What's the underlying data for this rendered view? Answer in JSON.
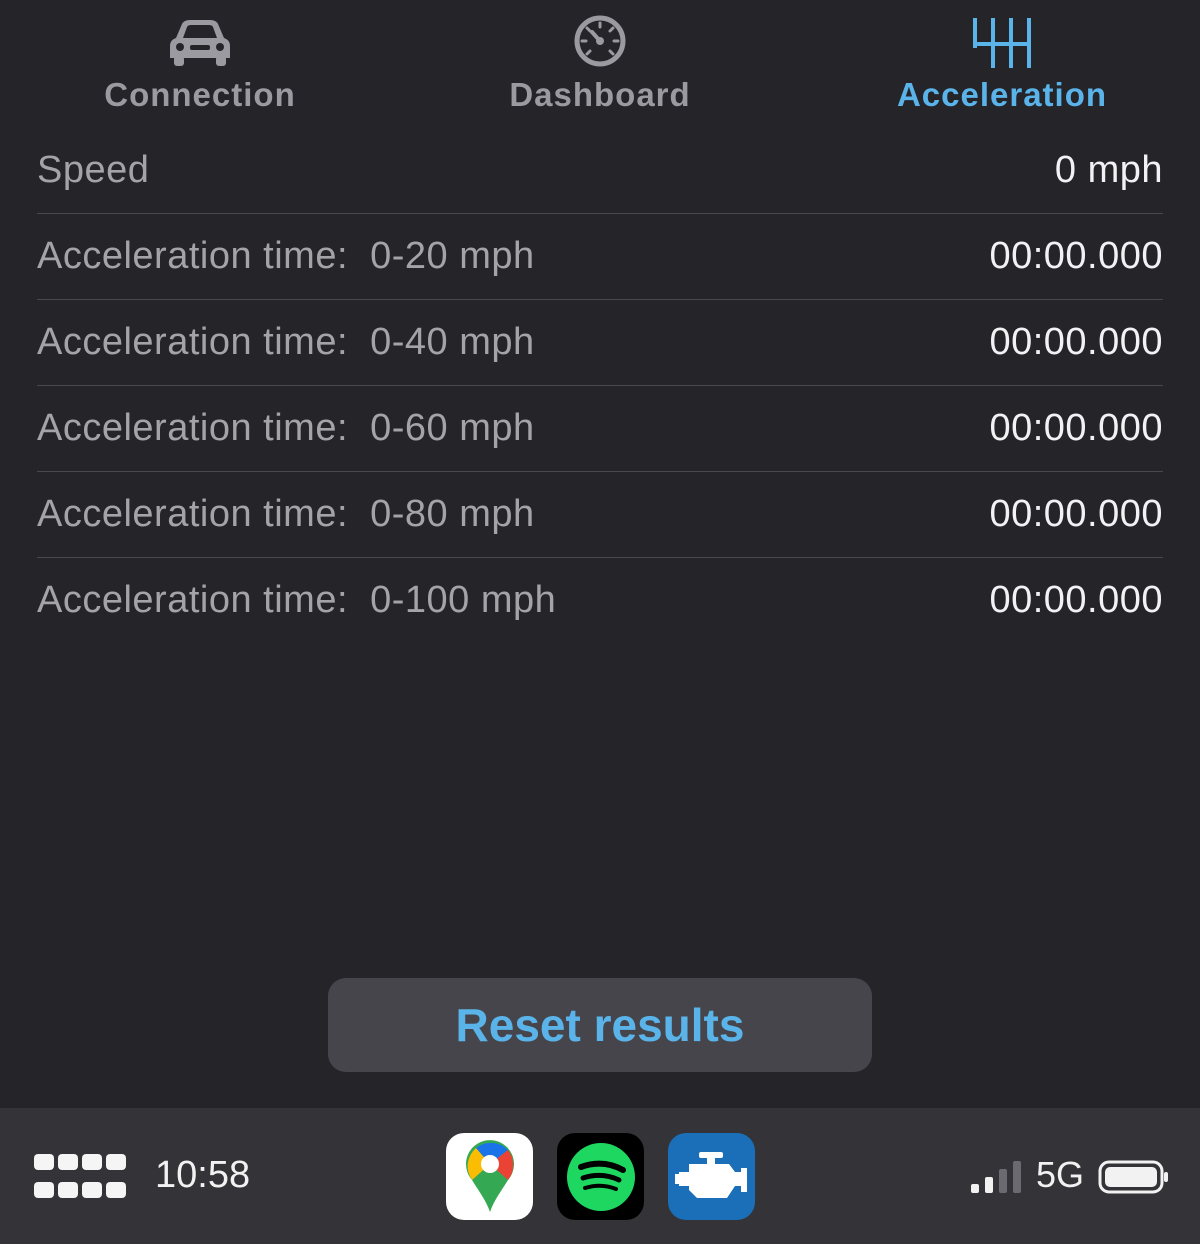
{
  "tabs": [
    {
      "label": "Connection",
      "icon": "car-icon",
      "active": false
    },
    {
      "label": "Dashboard",
      "icon": "speedometer-icon",
      "active": false
    },
    {
      "label": "Acceleration",
      "icon": "gear-shift-icon",
      "active": true
    }
  ],
  "speed": {
    "label": "Speed",
    "value": "0 mph"
  },
  "rows": [
    {
      "label": "Acceleration time:  0-20 mph",
      "value": "00:00.000"
    },
    {
      "label": "Acceleration time:  0-40 mph",
      "value": "00:00.000"
    },
    {
      "label": "Acceleration time:  0-60 mph",
      "value": "00:00.000"
    },
    {
      "label": "Acceleration time:  0-80 mph",
      "value": "00:00.000"
    },
    {
      "label": "Acceleration time:  0-100 mph",
      "value": "00:00.000"
    }
  ],
  "reset_label": "Reset results",
  "dock": {
    "time": "10:58",
    "network": "5G",
    "apps": [
      "google-maps-app-icon",
      "spotify-app-icon",
      "car-scanner-app-icon"
    ],
    "signal_bars": 2
  },
  "colors": {
    "background": "#242429",
    "accent": "#5ab4ea",
    "dock": "#333338"
  }
}
